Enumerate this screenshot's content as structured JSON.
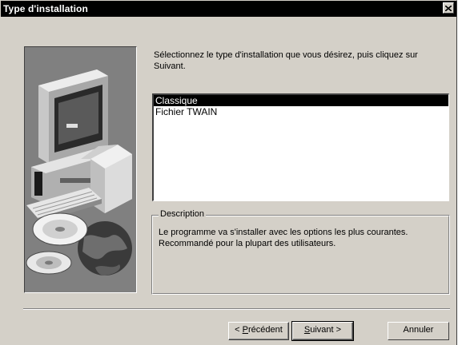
{
  "window": {
    "title": "Type d'installation"
  },
  "instruction": "Sélectionnez le type d'installation que vous désirez, puis cliquez sur Suivant.",
  "install_types": [
    {
      "label": "Classique",
      "selected": true
    },
    {
      "label": "Fichier TWAIN",
      "selected": false
    }
  ],
  "description": {
    "legend": "Description",
    "text": "Le programme va s'installer avec les options les plus courantes. Recommandé pour la plupart des utilisateurs."
  },
  "buttons": {
    "back": {
      "prefix": "< ",
      "mnemonic": "P",
      "rest": "récédent"
    },
    "next": {
      "mnemonic": "S",
      "rest": "uivant >"
    },
    "cancel": "Annuler"
  },
  "icons": {
    "close": "close-icon",
    "art": "computer-cd-globe-illustration"
  }
}
